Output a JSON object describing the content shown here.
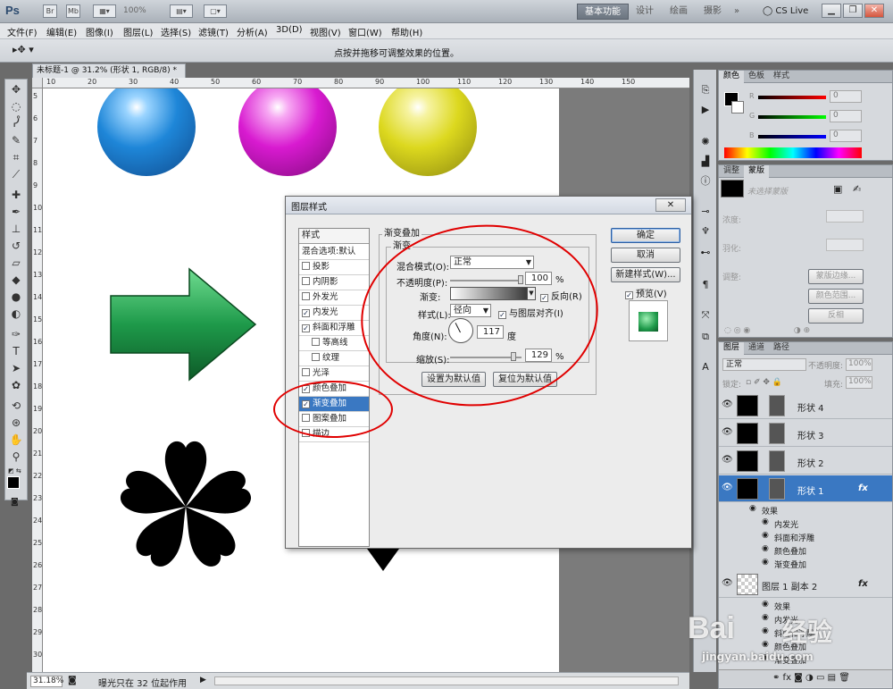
{
  "app": {
    "logo": "Ps",
    "zoom_display": "100%",
    "workspaces": [
      "基本功能",
      "设计",
      "绘画",
      "摄影"
    ],
    "more": "»",
    "cslive": "CS Live"
  },
  "menu": [
    "文件(F)",
    "编辑(E)",
    "图像(I)",
    "图层(L)",
    "选择(S)",
    "滤镜(T)",
    "分析(A)",
    "3D(D)",
    "视图(V)",
    "窗口(W)",
    "帮助(H)"
  ],
  "options": {
    "hint": "点按并拖移可调整效果的位置。"
  },
  "document": {
    "tab_title": "未标题-1 @ 31.2% (形状 1, RGB/8) *",
    "ruler_top": [
      "10",
      "20",
      "30",
      "40",
      "50",
      "60",
      "70",
      "80",
      "90",
      "100",
      "110",
      "120",
      "130",
      "140",
      "150"
    ],
    "ruler_left": [
      "5",
      "6",
      "7",
      "8",
      "9",
      "10",
      "11",
      "12",
      "13",
      "14",
      "15",
      "16",
      "17",
      "18",
      "19",
      "20",
      "21",
      "22",
      "23",
      "24",
      "25",
      "26",
      "27",
      "28",
      "29",
      "30"
    ],
    "colors": {
      "blue": "#1e86d8",
      "magenta": "#d81ad0",
      "yellow": "#dcd81e",
      "green": "#1e9a4a"
    }
  },
  "status": {
    "zoom": "31.18%",
    "info": "曝光只在 32 位起作用"
  },
  "color_panel": {
    "tabs": [
      "颜色",
      "色板",
      "样式"
    ],
    "r": "R",
    "g": "G",
    "b": "B",
    "r_val": "0",
    "g_val": "0",
    "b_val": "0"
  },
  "adjust_panel": {
    "tabs": [
      "调整",
      "蒙版"
    ],
    "no_mask": "未选择蒙版",
    "density": "浓度:",
    "feather": "羽化:",
    "refine": "调整:",
    "btn_edge": "蒙版边缘...",
    "btn_range": "颜色范围...",
    "btn_invert": "反相"
  },
  "layers_panel": {
    "tabs": [
      "图层",
      "通道",
      "路径"
    ],
    "blend": "正常",
    "opacity_label": "不透明度:",
    "opacity": "100%",
    "lock_label": "锁定:",
    "fill_label": "填充:",
    "fill": "100%",
    "layers": [
      "形状 4",
      "形状 3",
      "形状 2",
      "形状 1"
    ],
    "fx": "fx",
    "effects_label": "效果",
    "effects": [
      "内发光",
      "斜面和浮雕",
      "颜色叠加",
      "渐变叠加"
    ],
    "layer_copy": "图层 1 副本 2",
    "effects2": [
      "效果",
      "内发光",
      "斜面和浮雕",
      "颜色叠加",
      "渐变叠加"
    ]
  },
  "dialog": {
    "title": "图层样式",
    "close": "✕",
    "styles_header": "样式",
    "styles": [
      {
        "label": "混合选项:默认",
        "cb": false,
        "show_cb": false
      },
      {
        "label": "投影",
        "cb": false,
        "show_cb": true
      },
      {
        "label": "内阴影",
        "cb": false,
        "show_cb": true
      },
      {
        "label": "外发光",
        "cb": false,
        "show_cb": true
      },
      {
        "label": "内发光",
        "cb": true,
        "show_cb": true
      },
      {
        "label": "斜面和浮雕",
        "cb": true,
        "show_cb": true
      },
      {
        "label": "等高线",
        "cb": false,
        "show_cb": true
      },
      {
        "label": "纹理",
        "cb": false,
        "show_cb": true
      },
      {
        "label": "光泽",
        "cb": false,
        "show_cb": true
      },
      {
        "label": "颜色叠加",
        "cb": true,
        "show_cb": true
      },
      {
        "label": "渐变叠加",
        "cb": true,
        "show_cb": true
      },
      {
        "label": "图案叠加",
        "cb": false,
        "show_cb": true
      },
      {
        "label": "描边",
        "cb": false,
        "show_cb": true
      }
    ],
    "group_title": "渐变叠加",
    "sub_title": "渐变",
    "blend_label": "混合模式(O):",
    "blend_value": "正常",
    "opacity_label": "不透明度(P):",
    "opacity_value": "100",
    "pct": "%",
    "gradient_label": "渐变:",
    "reverse_label": "反向(R)",
    "style_label": "样式(L):",
    "style_value": "径向",
    "align_label": "与图层对齐(I)",
    "angle_label": "角度(N):",
    "angle_value": "117",
    "degree": "度",
    "scale_label": "缩放(S):",
    "scale_value": "129",
    "btn_set_default": "设置为默认值",
    "btn_reset_default": "复位为默认值",
    "btn_ok": "确定",
    "btn_cancel": "取消",
    "btn_new_style": "新建样式(W)...",
    "preview_label": "预览(V)"
  },
  "watermark": {
    "line1": "Bai",
    "line2": "经验",
    "line3": "jingyan.baidu.com"
  }
}
